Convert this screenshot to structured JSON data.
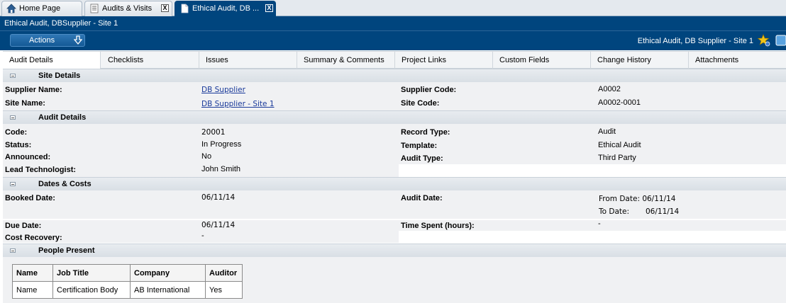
{
  "tabs": [
    {
      "label": "Home Page",
      "icon": "home-icon",
      "closable": false,
      "active": false
    },
    {
      "label": "Audits & Visits",
      "icon": "list-document-icon",
      "closable": true,
      "active": false
    },
    {
      "label": "Ethical Audit, DB ...",
      "icon": "document-icon",
      "closable": true,
      "active": true
    }
  ],
  "tab_close_glyph": "X",
  "title_bar": "Ethical Audit, DBSupplier - Site 1",
  "actions": {
    "label": "Actions",
    "icon": "download-arrow-icon"
  },
  "record_title": "Ethical Audit, DB Supplier - Site 1",
  "subtabs": [
    "Audit Details",
    "Checklists",
    "Issues",
    "Summary & Comments",
    "Project Links",
    "Custom Fields",
    "Change History",
    "Attachments"
  ],
  "sections": {
    "site": {
      "title": "Site Details",
      "supplier_name_label": "Supplier Name:",
      "supplier_name_value": "DB Supplier",
      "supplier_code_label": "Supplier Code:",
      "supplier_code_value": "A0002",
      "site_name_label": "Site Name:",
      "site_name_value": "DB Supplier - Site 1",
      "site_code_label": "Site Code:",
      "site_code_value": "A0002-0001"
    },
    "audit": {
      "title": "Audit Details",
      "code_label": "Code:",
      "code_value": "20001",
      "record_type_label": "Record Type:",
      "record_type_value": "Audit",
      "status_label": "Status:",
      "status_value": "In Progress",
      "template_label": "Template:",
      "template_value": "Ethical Audit",
      "announced_label": "Announced:",
      "announced_value": "No",
      "audit_type_label": "Audit Type:",
      "audit_type_value": "Third Party",
      "lead_label": "Lead Technologist:",
      "lead_value": "John Smith"
    },
    "dates": {
      "title": "Dates & Costs",
      "booked_label": "Booked Date:",
      "booked_value": "06/11/14",
      "audit_date_label": "Audit Date:",
      "from_date": "From Date: 06/11/14",
      "to_date_label": "To Date:",
      "to_date_value": "06/11/14",
      "due_label": "Due Date:",
      "due_value": "06/11/14",
      "time_label": "Time Spent (hours):",
      "time_value": "-",
      "cost_label": "Cost Recovery:",
      "cost_value": "-"
    },
    "people": {
      "title": "People Present",
      "headers": [
        "Name",
        "Job Title",
        "Company",
        "Auditor"
      ],
      "rows": [
        [
          "Name",
          "Certification Body",
          "AB International",
          "Yes"
        ]
      ]
    }
  },
  "colors": {
    "brand": "#00457e",
    "section_header": "#dde2e7",
    "link": "#1a3a9a"
  }
}
